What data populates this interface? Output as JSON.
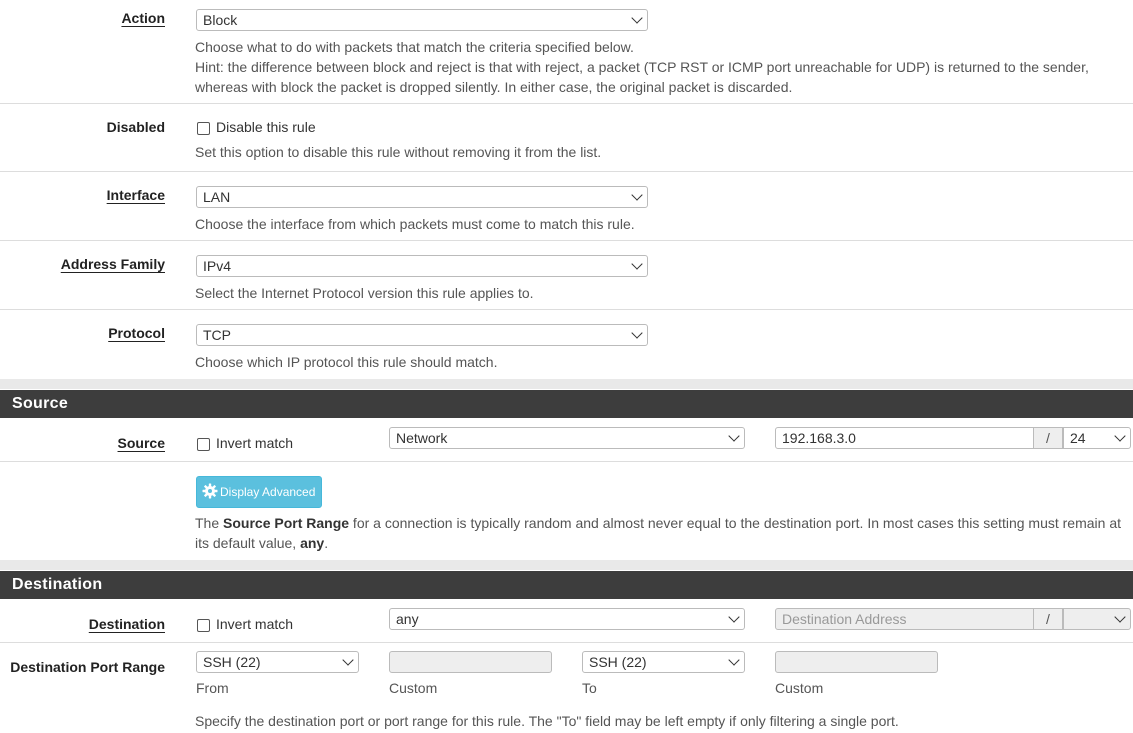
{
  "action": {
    "label": "Action",
    "value": "Block",
    "help1": "Choose what to do with packets that match the criteria specified below.",
    "help2": "Hint: the difference between block and reject is that with reject, a packet (TCP RST or ICMP port unreachable for UDP) is returned to the sender, whereas with block the packet is dropped silently. In either case, the original packet is discarded."
  },
  "disabled": {
    "label": "Disabled",
    "checkbox_label": "Disable this rule",
    "checked": false,
    "help": "Set this option to disable this rule without removing it from the list."
  },
  "interface": {
    "label": "Interface",
    "value": "LAN",
    "help": "Choose the interface from which packets must come to match this rule."
  },
  "address_family": {
    "label": "Address Family",
    "value": "IPv4",
    "help": "Select the Internet Protocol version this rule applies to."
  },
  "protocol": {
    "label": "Protocol",
    "value": "TCP",
    "help": "Choose which IP protocol this rule should match."
  },
  "source_section": {
    "title": "Source",
    "label": "Source",
    "invert_label": "Invert match",
    "type_value": "Network",
    "address_value": "192.168.3.0",
    "slash": "/",
    "mask_value": "24",
    "advanced_button": "Display Advanced",
    "help_pre": "The ",
    "help_bold1": "Source Port Range",
    "help_mid": " for a connection is typically random and almost never equal to the destination port. In most cases this setting must remain at its default value, ",
    "help_bold2": "any",
    "help_post": "."
  },
  "destination_section": {
    "title": "Destination",
    "label": "Destination",
    "invert_label": "Invert match",
    "type_value": "any",
    "address_placeholder": "Destination Address",
    "slash": "/",
    "mask_value": ""
  },
  "dest_port_range": {
    "label": "Destination Port Range",
    "from_value": "SSH (22)",
    "from_label": "From",
    "from_custom_label": "Custom",
    "to_value": "SSH (22)",
    "to_label": "To",
    "to_custom_label": "Custom",
    "help": "Specify the destination port or port range for this rule. The \"To\" field may be left empty if only filtering a single port."
  },
  "colors": {
    "section_header_bg": "#3d3d3d",
    "info_button": "#5bc0de"
  },
  "icons": [
    "chevron-down-icon",
    "gear-icon"
  ]
}
